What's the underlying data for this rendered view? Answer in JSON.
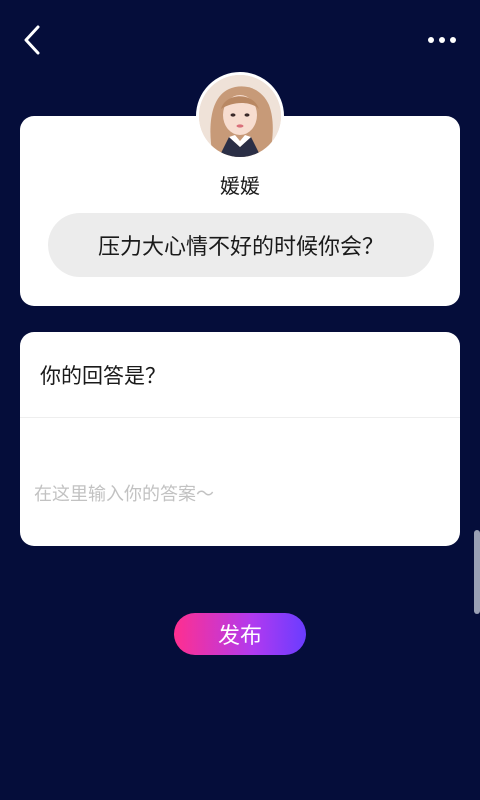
{
  "header": {
    "back_icon": "chevron-left-icon",
    "more_icon": "more-horizontal-icon"
  },
  "question_card": {
    "username": "媛媛",
    "question": "压力大心情不好的时候你会？"
  },
  "answer_card": {
    "title": "你的回答是？",
    "input_value": "",
    "input_placeholder": "在这里输入你的答案～"
  },
  "publish_button": {
    "label": "发布"
  },
  "colors": {
    "background": "#050d3a",
    "card": "#ffffff",
    "bubble": "#ececec",
    "button_gradient_start": "#ff2f8f",
    "button_gradient_end": "#6a3cff"
  }
}
